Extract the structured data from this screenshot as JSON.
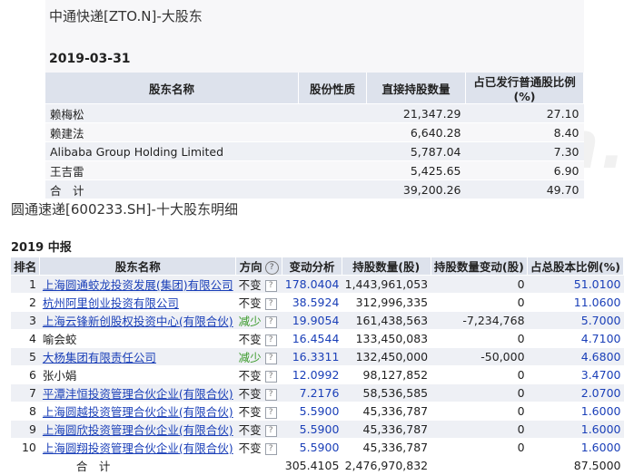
{
  "section1": {
    "title": "中通快递[ZTO.N]-大股东",
    "date": "2019-03-31",
    "headers": [
      "股东名称",
      "股份性质",
      "直接持股数量",
      "占已发行普通股比例(%)"
    ],
    "rows": [
      {
        "name": "赖梅松",
        "type": "",
        "shares": "21,347.29",
        "ratio": "27.10"
      },
      {
        "name": "赖建法",
        "type": "",
        "shares": "6,640.28",
        "ratio": "8.40"
      },
      {
        "name": "Alibaba Group Holding Limited",
        "type": "",
        "shares": "5,787.04",
        "ratio": "7.30"
      },
      {
        "name": "王吉雷",
        "type": "",
        "shares": "5,425.65",
        "ratio": "6.90"
      }
    ],
    "total": {
      "label": "合　计",
      "shares": "39,200.26",
      "ratio": "49.70"
    }
  },
  "section2": {
    "title": "圆通速递[600233.SH]-十大股东明细",
    "date": "2019 中报",
    "headers": [
      "排名",
      "股东名称",
      "方向",
      "变动分析",
      "持股数量(股)",
      "持股数量变动(股)",
      "占总股本比例(%)"
    ],
    "help_icon": "?",
    "rows": [
      {
        "rank": "1",
        "name": "上海圆通蛟龙投资发展(集团)有限公司",
        "direction": "不变",
        "dir_type": "stay",
        "analysis": "178.0404",
        "shares": "1,443,961,053",
        "change": "0",
        "ratio": "51.0100"
      },
      {
        "rank": "2",
        "name": "杭州阿里创业投资有限公司",
        "direction": "不变",
        "dir_type": "stay",
        "analysis": "38.5924",
        "shares": "312,996,335",
        "change": "0",
        "ratio": "11.0600"
      },
      {
        "rank": "3",
        "name": "上海云锋新创股权投资中心(有限合伙)",
        "direction": "减少",
        "dir_type": "down",
        "analysis": "19.9054",
        "shares": "161,438,563",
        "change": "-7,234,768",
        "ratio": "5.7000"
      },
      {
        "rank": "4",
        "name": "喻会蛟",
        "direction": "不变",
        "dir_type": "stay",
        "analysis": "16.4544",
        "shares": "133,450,083",
        "change": "0",
        "ratio": "4.7100"
      },
      {
        "rank": "5",
        "name": "大杨集团有限责任公司",
        "direction": "减少",
        "dir_type": "down",
        "analysis": "16.3311",
        "shares": "132,450,000",
        "change": "-50,000",
        "ratio": "4.6800"
      },
      {
        "rank": "6",
        "name": "张小娟",
        "direction": "不变",
        "dir_type": "stay",
        "analysis": "12.0992",
        "shares": "98,127,852",
        "change": "0",
        "ratio": "3.4700"
      },
      {
        "rank": "7",
        "name": "平潭沣恒投资管理合伙企业(有限合伙)",
        "direction": "不变",
        "dir_type": "stay",
        "analysis": "7.2176",
        "shares": "58,536,585",
        "change": "0",
        "ratio": "2.0700"
      },
      {
        "rank": "8",
        "name": "上海圆越投资管理合伙企业(有限合伙)",
        "direction": "不变",
        "dir_type": "stay",
        "analysis": "5.5900",
        "shares": "45,336,787",
        "change": "0",
        "ratio": "1.6000"
      },
      {
        "rank": "9",
        "name": "上海圆欣投资管理合伙企业(有限合伙)",
        "direction": "不变",
        "dir_type": "stay",
        "analysis": "5.5900",
        "shares": "45,336,787",
        "change": "0",
        "ratio": "1.6000"
      },
      {
        "rank": "10",
        "name": "上海圆翔投资管理合伙企业(有限合伙)",
        "direction": "不变",
        "dir_type": "stay",
        "analysis": "5.5900",
        "shares": "45,336,787",
        "change": "0",
        "ratio": "1.6000"
      }
    ],
    "total": {
      "label": "合　计",
      "analysis": "305.4105",
      "shares": "2,476,970,832",
      "ratio": "87.5000"
    }
  },
  "watermark": "Win.d",
  "colors": {
    "header_bg": "#dde2ec",
    "row_alt": "#eef0f5",
    "link": "#1a3fb8",
    "decrease": "#3a9a2a"
  }
}
